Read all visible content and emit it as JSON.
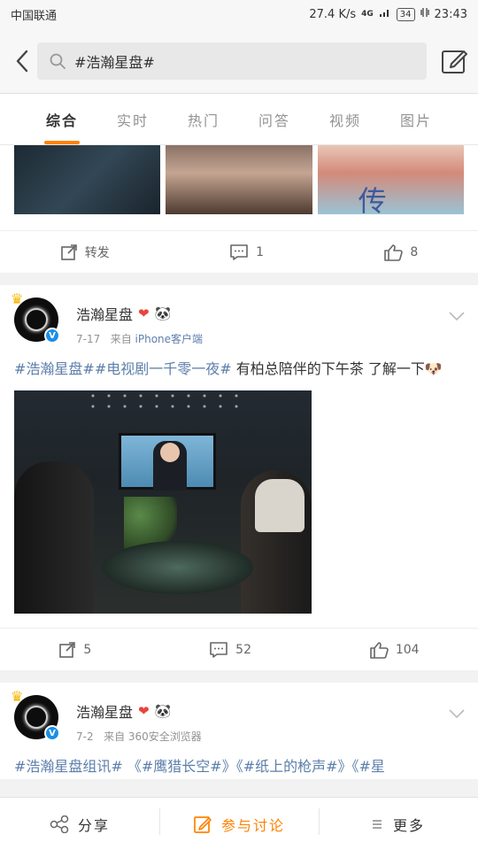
{
  "status_bar": {
    "carrier": "中国联通",
    "speed": "27.4 K/s",
    "network": "4G",
    "battery": "34",
    "time": "23:43"
  },
  "search": {
    "query": "#浩瀚星盘#"
  },
  "tabs": [
    {
      "label": "综合",
      "active": true
    },
    {
      "label": "实时"
    },
    {
      "label": "热门"
    },
    {
      "label": "问答"
    },
    {
      "label": "视频"
    },
    {
      "label": "图片"
    }
  ],
  "card_top": {
    "image3_glyph": "传",
    "actions": {
      "repost": "转发",
      "comments": "1",
      "likes": "8"
    }
  },
  "post1": {
    "username": "浩瀚星盘",
    "date": "7-17",
    "from_label": "来自",
    "source": "iPhone客户端",
    "text_topics": [
      "#浩瀚星盘#",
      "#电视剧一千零一夜#"
    ],
    "text_body": " 有柏总陪伴的下午茶 了解一下",
    "actions": {
      "reposts": "5",
      "comments": "52",
      "likes": "104"
    }
  },
  "post2": {
    "username": "浩瀚星盘",
    "date": "7-2",
    "source_text": "来自 360安全浏览器",
    "text": "#浩瀚星盘组讯# 《#鹰猎长空#》《#纸上的枪声#》《#星"
  },
  "bottom_bar": {
    "share": "分享",
    "discuss": "参与讨论",
    "more": "更多"
  },
  "colors": {
    "accent": "#ff8200",
    "link": "#5d7fab",
    "verified": "#1a8fe6"
  }
}
